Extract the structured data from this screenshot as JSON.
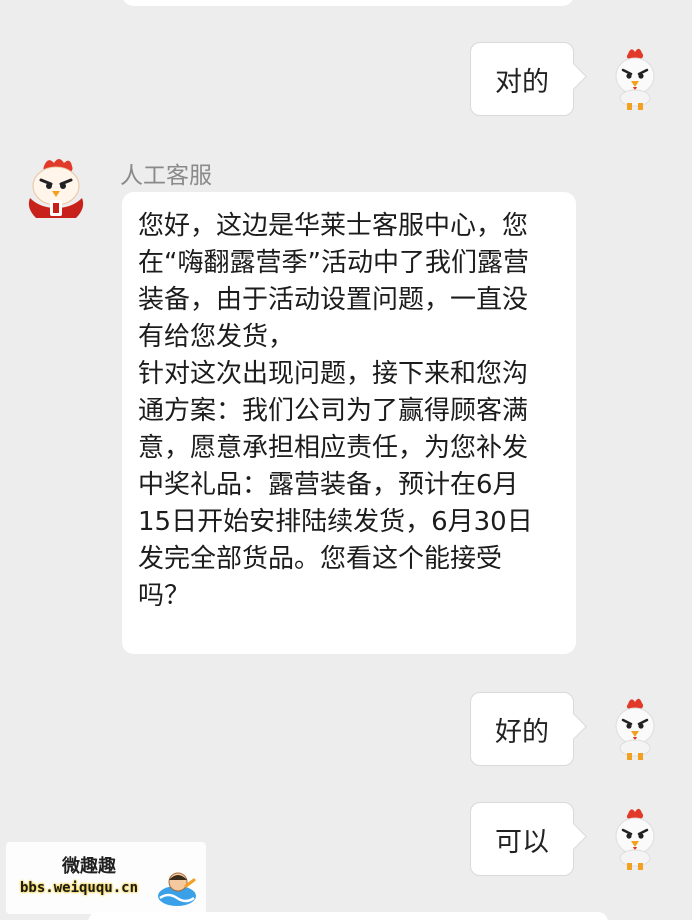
{
  "messages": [
    {
      "side": "right",
      "text": "对的"
    },
    {
      "side": "left",
      "sender": "人工客服",
      "text": "您好，这边是华莱士客服中心，您\n在“嗨翻露营季”活动中了我们露营\n装备，由于活动设置问题，一直没\n有给您发货，\n针对这次出现问题，接下来和您沟\n通方案：我们公司为了赢得顾客满\n意，愿意承担相应责任，为您补发\n中奖礼品：露营装备，预计在6月\n15日开始安排陆续发货，6月30日\n发完全部货品。您看这个能接受\n吗？"
    },
    {
      "side": "right",
      "text": "好的"
    },
    {
      "side": "right",
      "text": "可以"
    }
  ],
  "watermark": {
    "title": "微趣趣",
    "url": "bbs.weiququ.cn"
  },
  "colors": {
    "background": "#ededed",
    "bubble": "#ffffff",
    "sender_name": "#8a8a8a"
  }
}
